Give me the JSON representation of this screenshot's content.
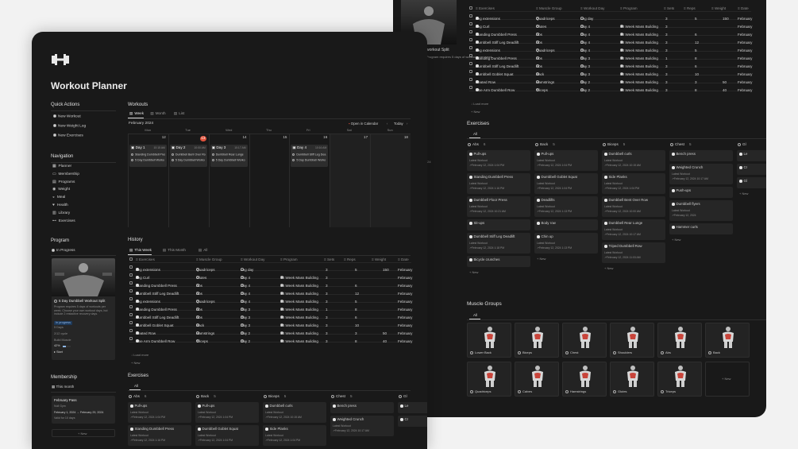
{
  "page": {
    "title": "Workout Planner"
  },
  "quick": {
    "title": "Quick Actions",
    "items": [
      "New Workout",
      "New Weight Log",
      "New Exercises"
    ]
  },
  "nav": {
    "title": "Navigation",
    "items": [
      {
        "icon": "calendar-icon",
        "label": "Planner"
      },
      {
        "icon": "card-icon",
        "label": "Membership"
      },
      {
        "icon": "folder-icon",
        "label": "Programs"
      },
      {
        "icon": "scale-icon",
        "label": "Weight"
      },
      {
        "icon": "meal-icon",
        "label": "Meal"
      },
      {
        "icon": "heart-icon",
        "label": "Health"
      },
      {
        "icon": "book-icon",
        "label": "Library"
      },
      {
        "icon": "dumbbell-icon",
        "label": "Exercises"
      }
    ]
  },
  "program": {
    "title": "Program",
    "filter": "In Progress",
    "card_title": "5 Day Dumbbell Workout Split",
    "card_desc": "Program requires 5 days of workouts per week. Choose your own workout days, but include 2 restactive recovery days.",
    "status": "In progress",
    "days": "5 Days",
    "cycle": "2/12 cycle",
    "goal": "Build Muscle",
    "progress_label": "42%",
    "progress": 0.42,
    "start": "Start"
  },
  "membership": {
    "title": "Membership",
    "filter": "This month",
    "card_title": "February Pass",
    "card_status": "Null Gym",
    "card_dates": "February 1, 2024 → February 29, 2024",
    "card_note": "Valid for 10 days",
    "new": "+ New"
  },
  "workouts": {
    "title": "Workouts",
    "tabs": [
      "Week",
      "Month",
      "List"
    ],
    "month": "February 2024",
    "open_cal": "Open in Calendar",
    "today": "Today",
    "days": [
      "Mon",
      "Tue",
      "Wed",
      "Thu",
      "Fri",
      "Sat",
      "Sun"
    ],
    "dates": [
      "12",
      "13",
      "14",
      "15",
      "16",
      "17",
      "18"
    ],
    "events": [
      {
        "col": 0,
        "title": "Day 1",
        "time": "10:15 AM",
        "lines": [
          "Standing Dumbbell Press",
          "5 Day Dumbbell Worko"
        ]
      },
      {
        "col": 1,
        "title": "Day 2",
        "time": "10:00 AM",
        "lines": [
          "Dumbbell Bent Over Ro",
          "5 Day Dumbbell Worko"
        ]
      },
      {
        "col": 2,
        "title": "Day 3",
        "time": "10:17 AM",
        "lines": [
          "Dumbbell Rear Lunge",
          "5 Day Dumbbell Worko"
        ]
      },
      {
        "col": 4,
        "title": "Day 4",
        "time": "10:16 AM",
        "lines": [
          "Dumbbell Stiff Leg Dea",
          "5 Day Dumbbell Worko"
        ]
      }
    ]
  },
  "history": {
    "title": "History",
    "tabs": [
      "This Week",
      "This Month",
      "All"
    ],
    "headers": [
      "Exercises",
      "Muscle Group",
      "Workout Day",
      "Program",
      "Sets",
      "Reps",
      "Weight",
      "Date"
    ],
    "rows": [
      [
        "Leg extensions",
        "Quadriceps",
        "Leg day",
        "",
        "3",
        "5",
        "150",
        "February"
      ],
      [
        "Leg Curl",
        "Glutes",
        "Day 4",
        "10 Week Mass Building",
        "3",
        "",
        "",
        "February"
      ],
      [
        "Standing Dumbbell Press",
        "Abs",
        "Day 4",
        "10 Week Mass Building",
        "3",
        "6",
        "",
        "February"
      ],
      [
        "Dumbbell Stiff Leg Deadlift",
        "Abs",
        "Day 4",
        "10 Week Mass Building",
        "3",
        "12",
        "",
        "February"
      ],
      [
        "Leg extensions",
        "Quadriceps",
        "Day 4",
        "10 Week Mass Building",
        "3",
        "5",
        "",
        "February"
      ],
      [
        "Standing Dumbbell Press",
        "Abs",
        "Day 3",
        "10 Week Mass Building",
        "1",
        "8",
        "",
        "February"
      ],
      [
        "Dumbbell Stiff Leg Deadlift",
        "Abs",
        "Day 3",
        "10 Week Mass Building",
        "3",
        "6",
        "",
        "February"
      ],
      [
        "Dumbbell Goblet Squat",
        "Back",
        "Day 3",
        "10 Week Mass Building",
        "3",
        "10",
        "",
        "February"
      ],
      [
        "Seated Row",
        "Hamstrings",
        "Day 2",
        "10 Week Mass Building",
        "3",
        "3",
        "50",
        "February"
      ],
      [
        "One Arm Dumbbell Row",
        "Triceps",
        "Day 2",
        "10 Week Mass Building",
        "3",
        "8",
        "40",
        "February"
      ]
    ],
    "load_more": "Load more",
    "new": "+ New"
  },
  "exercises": {
    "title": "Exercises",
    "tab": "All",
    "latest": "Latest Workout",
    "columns": [
      {
        "name": "Abs",
        "count": "6",
        "cards": [
          [
            "Pull-ups",
            "February 12, 2024 1:04 PM"
          ],
          [
            "Standing Dumbbell Press",
            "February 12, 2024 1:16 PM"
          ],
          [
            "Dumbbell Floor Press",
            "February 12, 2024 10:21 AM"
          ],
          [
            "Sit-ups",
            ""
          ],
          [
            "Dumbbell Stiff Leg Deadlift",
            "February 12, 2024 1:18 PM"
          ],
          [
            "Bicycle crunches",
            ""
          ]
        ]
      },
      {
        "name": "Back",
        "count": "5",
        "cards": [
          [
            "Pull-ups",
            "February 12, 2024 1:04 PM"
          ],
          [
            "Dumbbell Goblet Squat",
            "February 12, 2024 1:04 PM"
          ],
          [
            "Deadlifts",
            "February 12, 2024 1:13 PM"
          ],
          [
            "Body row",
            ""
          ],
          [
            "Chin up",
            "February 12, 2024 1:13 PM"
          ]
        ]
      },
      {
        "name": "Biceps",
        "count": "5",
        "cards": [
          [
            "Dumbbell curls",
            "February 12, 2024 10:15 AM"
          ],
          [
            "Side Planks",
            "February 12, 2024 1:04 PM"
          ],
          [
            "Dumbbell Bent Over Row",
            "February 12, 2024 10:00 AM"
          ],
          [
            "Dumbbell Rear Lunge",
            "February 12, 2024 10:17 AM"
          ],
          [
            "Triped Dumbbell Row",
            "February 12, 2024 11:03 AM"
          ]
        ]
      },
      {
        "name": "Chest",
        "count": "5",
        "cards": [
          [
            "Bench press",
            ""
          ],
          [
            "Weighted Crunch",
            "February 12, 2024 10:17 AM"
          ],
          [
            "Push-ups",
            ""
          ],
          [
            "Dumbbell flyers",
            "February 12, 2024"
          ],
          [
            "Hammer curls",
            ""
          ]
        ]
      },
      {
        "name": "Gl",
        "count": "",
        "cards": [
          [
            "Le",
            ""
          ],
          [
            "Cr",
            ""
          ],
          [
            "Gl",
            ""
          ]
        ]
      }
    ]
  },
  "muscle": {
    "title": "Muscle Groups",
    "tab": "All",
    "items": [
      "Lower Back",
      "Biceps",
      "Chest",
      "Shoulders",
      "Abs",
      "Back",
      "Quadriceps",
      "Calves",
      "Hamstrings",
      "Glutes",
      "Triceps"
    ],
    "new": "+ New"
  },
  "back_panel": {
    "split_title": "workout Split",
    "split_desc": "Program requires 5 days of workouts per week.",
    "date": "29, 2024"
  }
}
